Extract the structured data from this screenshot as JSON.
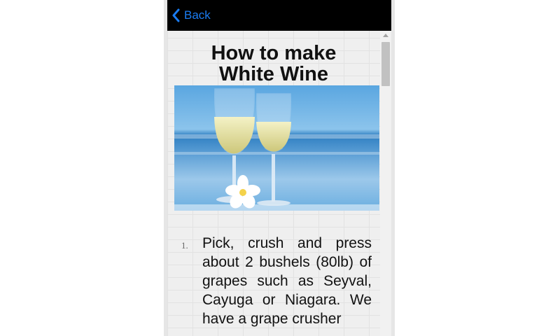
{
  "topbar": {
    "back_label": "Back",
    "back_icon": "chevron-left-icon",
    "accent_color": "#1a7cf2"
  },
  "article": {
    "title_line1": "How to make",
    "title_line2": "White Wine",
    "hero_image": "white-wine-glasses-beach-photo",
    "steps": [
      {
        "number": "1.",
        "text": "Pick, crush and press about 2 bushels (80lb) of grapes such as Seyval, Cayuga or Niagara. We have a grape crusher"
      }
    ]
  }
}
